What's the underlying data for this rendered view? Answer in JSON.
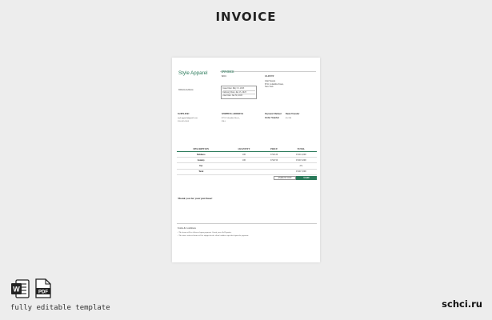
{
  "heading": "INVOICE",
  "invoice": {
    "company": "Style Apparel",
    "invoice_label": "INVOICE",
    "invoice_number": "$001",
    "client_label": "CLIENT",
    "client_lines": [
      "John Weston",
      "8721 Columbia Street,",
      "New York"
    ],
    "website": "Website Address",
    "dates": [
      "Issue Date: May 15, 2023",
      "Delivery Date: Jun 15, 2023",
      "Due Date: Jun 30, 2023"
    ],
    "supplier": {
      "label": "SUPPLIER:",
      "lines": [
        "styleapparel@gmail.com",
        "555-555-5555"
      ]
    },
    "shipping": {
      "label": "SHIPPING ADDRESS",
      "lines": [
        "8721 Columbia Street,",
        "USA"
      ]
    },
    "payment": {
      "method_label": "Payment Method",
      "method_value": "Bank Transfer",
      "order_label": "Order Number",
      "order_value": "45-356"
    },
    "table": {
      "headers": [
        "DESCRIPTION",
        "QUANTITY",
        "PRICE",
        "TOTAL"
      ],
      "rows": [
        {
          "description": "Boldness",
          "quantity": "100",
          "price": "USD 20",
          "total": "USD 2,000"
        },
        {
          "description": "Sunday",
          "quantity": "100",
          "price": "USD 50",
          "total": "USD 5,000"
        },
        {
          "description": "Tax",
          "quantity": "",
          "price": "",
          "total": "2%"
        },
        {
          "description": "Total",
          "quantity": "",
          "price": "",
          "total": "USD 7,000"
        }
      ]
    },
    "amount_due_label": "AMOUNT DUE",
    "amount_due_value": "$7,000",
    "thank_you": "Thank you for your purchase!",
    "terms": {
      "title": "Terms & Conditions",
      "lines": [
        "• The items will be delivered upon payment. Goods, taxes & Deposits.",
        "• The above ordered items will be shipped to the client's address specified upon the payment."
      ]
    }
  },
  "footer": {
    "caption": "fully editable template",
    "watermark": "schci.ru",
    "pdf_text": "PDF",
    "word_letter": "W"
  },
  "colors": {
    "accent": "#2a7a5a",
    "background": "#ededed"
  }
}
